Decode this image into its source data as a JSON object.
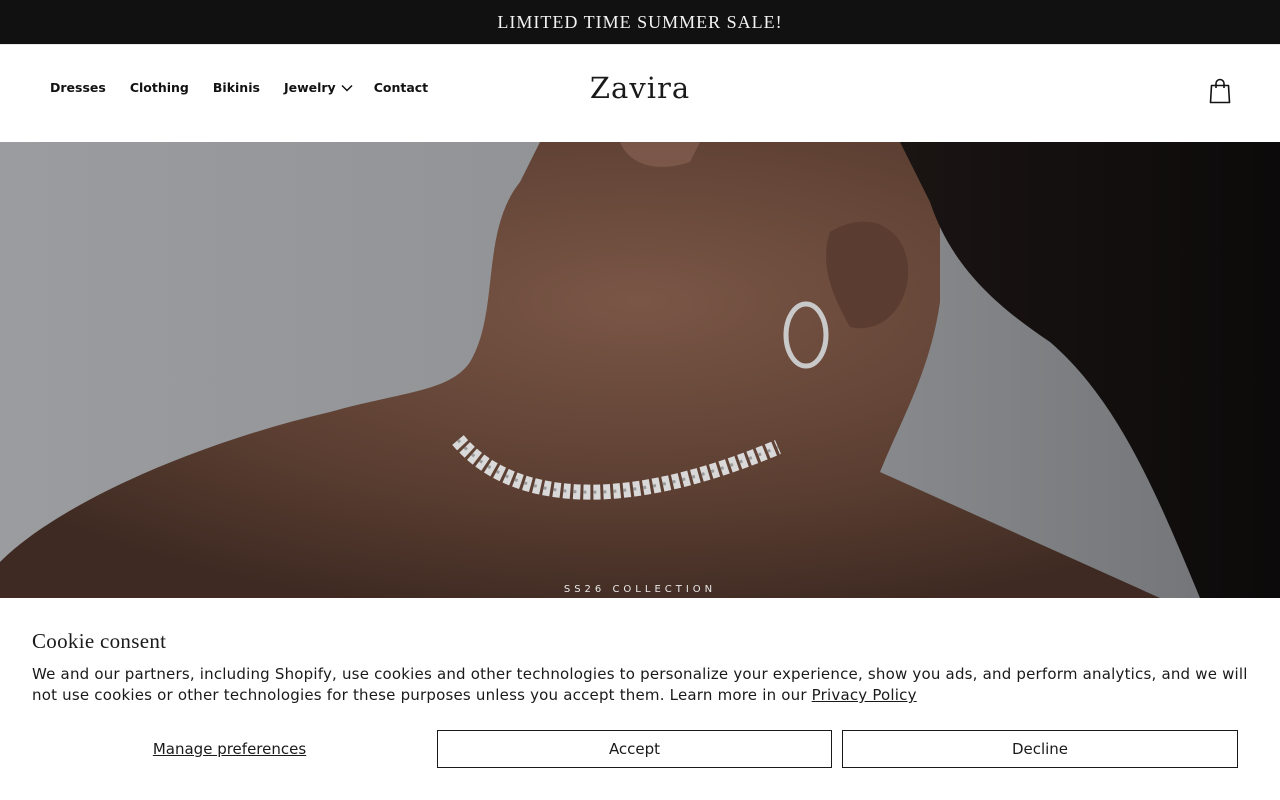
{
  "announcement": {
    "text": "LIMITED TIME SUMMER SALE!"
  },
  "header": {
    "nav": [
      {
        "label": "Dresses"
      },
      {
        "label": "Clothing"
      },
      {
        "label": "Bikinis"
      },
      {
        "label": "Jewelry",
        "icon": "chevron-down-icon"
      },
      {
        "label": "Contact"
      }
    ],
    "logo": "Zavira",
    "cart_icon": "shopping-bag-icon"
  },
  "hero": {
    "eyebrow": "SS26 COLLECTION",
    "image": "model wearing silver chain choker and hoop earring"
  },
  "cookie": {
    "title": "Cookie consent",
    "body": "We and our partners, including Shopify, use cookies and other technologies to personalize your experience, show you ads, and perform analytics, and we will not use cookies or other technologies for these purposes unless you accept them. Learn more in our ",
    "privacy_link": "Privacy Policy",
    "manage_label": "Manage preferences",
    "accept_label": "Accept",
    "decline_label": "Decline"
  },
  "colors": {
    "announcement_bg": "#111111",
    "text": "#1a1a1a",
    "background": "#ffffff"
  }
}
